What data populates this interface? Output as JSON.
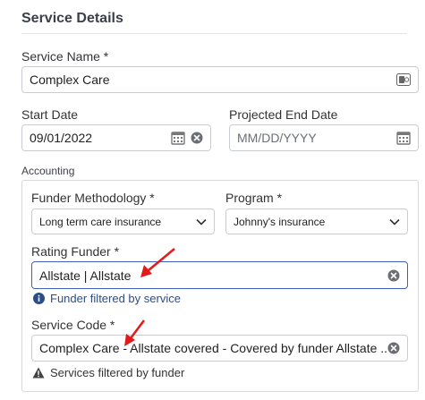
{
  "section_title": "Service Details",
  "service_name": {
    "label": "Service Name *",
    "value": "Complex Care"
  },
  "start_date": {
    "label": "Start Date",
    "value": "09/01/2022"
  },
  "projected_end_date": {
    "label": "Projected End Date",
    "placeholder": "MM/DD/YYYY"
  },
  "accounting": {
    "title": "Accounting",
    "funder_methodology": {
      "label": "Funder Methodology *",
      "value": "Long term care insurance"
    },
    "program": {
      "label": "Program *",
      "value": "Johnny's insurance"
    },
    "rating_funder": {
      "label": "Rating Funder *",
      "value": "Allstate | Allstate",
      "hint": "Funder filtered by service"
    },
    "service_code": {
      "label": "Service Code *",
      "value": "Complex Care - Allstate covered - Covered by funder Allstate ...",
      "hint": "Services filtered by funder"
    }
  },
  "icons": {
    "calendar": "calendar-icon",
    "clear": "clear-circle-icon",
    "chevron": "chevron-down-icon",
    "info": "info-circle-icon",
    "warning": "warning-triangle-icon",
    "id_card": "id-card-icon"
  },
  "colors": {
    "accent": "#3f5fbf",
    "info": "#2b4d8c",
    "annotation": "#e01b1b"
  }
}
